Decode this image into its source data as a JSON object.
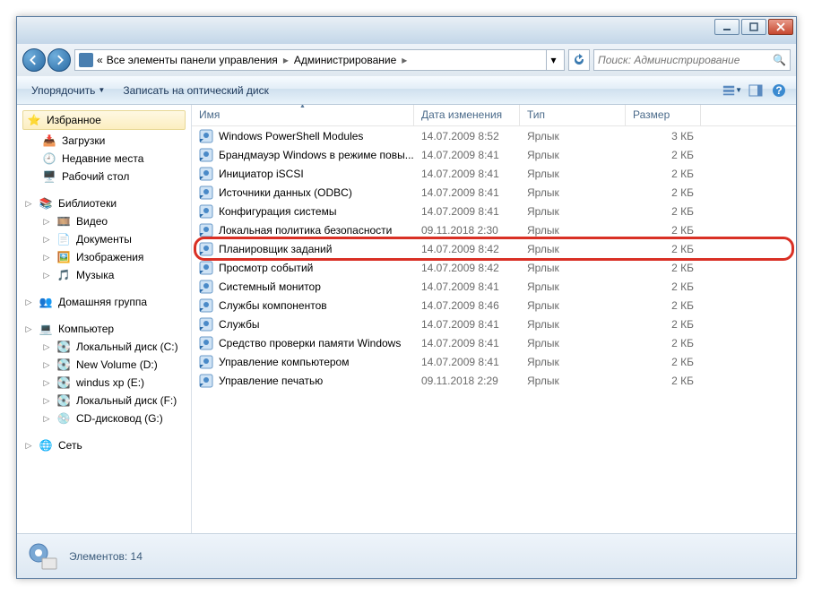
{
  "breadcrumb": {
    "prefix": "«",
    "parent": "Все элементы панели управления",
    "current": "Администрирование"
  },
  "search": {
    "placeholder": "Поиск: Администрирование"
  },
  "toolbar": {
    "organize": "Упорядочить",
    "burn": "Записать на оптический диск"
  },
  "sidebar": {
    "favorites": {
      "label": "Избранное",
      "items": [
        "Загрузки",
        "Недавние места",
        "Рабочий стол"
      ]
    },
    "libraries": {
      "label": "Библиотеки",
      "items": [
        "Видео",
        "Документы",
        "Изображения",
        "Музыка"
      ]
    },
    "homegroup": {
      "label": "Домашняя группа"
    },
    "computer": {
      "label": "Компьютер",
      "items": [
        "Локальный диск (C:)",
        "New Volume (D:)",
        "windus xp (E:)",
        "Локальный диск (F:)",
        "CD-дисковод (G:)"
      ]
    },
    "network": {
      "label": "Сеть"
    }
  },
  "columns": {
    "name": "Имя",
    "date": "Дата изменения",
    "type": "Тип",
    "size": "Размер"
  },
  "col_widths": {
    "name": 248,
    "date": 118,
    "type": 118,
    "size": 84
  },
  "files": [
    {
      "name": "Windows PowerShell Modules",
      "date": "14.07.2009 8:52",
      "type": "Ярлык",
      "size": "3 КБ"
    },
    {
      "name": "Брандмауэр Windows в режиме повы...",
      "date": "14.07.2009 8:41",
      "type": "Ярлык",
      "size": "2 КБ"
    },
    {
      "name": "Инициатор iSCSI",
      "date": "14.07.2009 8:41",
      "type": "Ярлык",
      "size": "2 КБ"
    },
    {
      "name": "Источники данных (ODBC)",
      "date": "14.07.2009 8:41",
      "type": "Ярлык",
      "size": "2 КБ"
    },
    {
      "name": "Конфигурация системы",
      "date": "14.07.2009 8:41",
      "type": "Ярлык",
      "size": "2 КБ"
    },
    {
      "name": "Локальная политика безопасности",
      "date": "09.11.2018 2:30",
      "type": "Ярлык",
      "size": "2 КБ"
    },
    {
      "name": "Планировщик заданий",
      "date": "14.07.2009 8:42",
      "type": "Ярлык",
      "size": "2 КБ",
      "highlight": true
    },
    {
      "name": "Просмотр событий",
      "date": "14.07.2009 8:42",
      "type": "Ярлык",
      "size": "2 КБ"
    },
    {
      "name": "Системный монитор",
      "date": "14.07.2009 8:41",
      "type": "Ярлык",
      "size": "2 КБ"
    },
    {
      "name": "Службы компонентов",
      "date": "14.07.2009 8:46",
      "type": "Ярлык",
      "size": "2 КБ"
    },
    {
      "name": "Службы",
      "date": "14.07.2009 8:41",
      "type": "Ярлык",
      "size": "2 КБ"
    },
    {
      "name": "Средство проверки памяти Windows",
      "date": "14.07.2009 8:41",
      "type": "Ярлык",
      "size": "2 КБ"
    },
    {
      "name": "Управление компьютером",
      "date": "14.07.2009 8:41",
      "type": "Ярлык",
      "size": "2 КБ"
    },
    {
      "name": "Управление печатью",
      "date": "09.11.2018 2:29",
      "type": "Ярлык",
      "size": "2 КБ"
    }
  ],
  "status": {
    "label": "Элементов: 14"
  }
}
